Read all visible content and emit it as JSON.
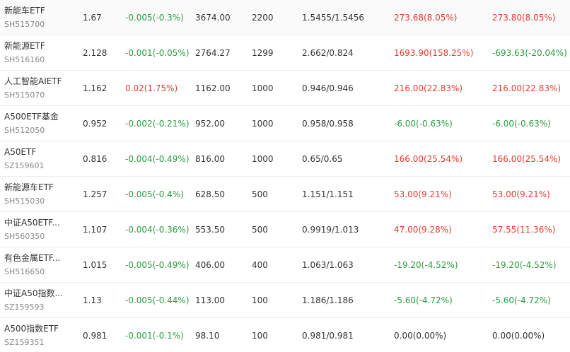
{
  "colors": {
    "up": "#e43c2f",
    "down": "#2a9d3f",
    "flat": "#333333"
  },
  "rows": [
    {
      "name": "新能车ETF",
      "code": "SH515700",
      "price": "1.67",
      "change": "-0.005(-0.3%)",
      "change_dir": "down",
      "market_value": "3674.00",
      "quantity": "2200",
      "cost": "1.5455/1.5456",
      "pnl": "273.68(8.05%)",
      "pnl_dir": "up",
      "pnl2": "273.80(8.05%)",
      "pnl2_dir": "up"
    },
    {
      "name": "新能源ETF",
      "code": "SH516160",
      "price": "2.128",
      "change": "-0.001(-0.05%)",
      "change_dir": "down",
      "market_value": "2764.27",
      "quantity": "1299",
      "cost": "2.662/0.824",
      "pnl": "1693.90(158.25%)",
      "pnl_dir": "up",
      "pnl2": "-693.63(-20.04%)",
      "pnl2_dir": "down"
    },
    {
      "name": "人工智能AIETF",
      "code": "SH515070",
      "price": "1.162",
      "change": "0.02(1.75%)",
      "change_dir": "up",
      "market_value": "1162.00",
      "quantity": "1000",
      "cost": "0.946/0.946",
      "pnl": "216.00(22.83%)",
      "pnl_dir": "up",
      "pnl2": "216.00(22.83%)",
      "pnl2_dir": "up"
    },
    {
      "name": "A500ETF基金",
      "code": "SH512050",
      "price": "0.952",
      "change": "-0.002(-0.21%)",
      "change_dir": "down",
      "market_value": "952.00",
      "quantity": "1000",
      "cost": "0.958/0.958",
      "pnl": "-6.00(-0.63%)",
      "pnl_dir": "down",
      "pnl2": "-6.00(-0.63%)",
      "pnl2_dir": "down"
    },
    {
      "name": "A50ETF",
      "code": "SZ159601",
      "price": "0.816",
      "change": "-0.004(-0.49%)",
      "change_dir": "down",
      "market_value": "816.00",
      "quantity": "1000",
      "cost": "0.65/0.65",
      "pnl": "166.00(25.54%)",
      "pnl_dir": "up",
      "pnl2": "166.00(25.54%)",
      "pnl2_dir": "up"
    },
    {
      "name": "新能源车ETF",
      "code": "SH515030",
      "price": "1.257",
      "change": "-0.005(-0.4%)",
      "change_dir": "down",
      "market_value": "628.50",
      "quantity": "500",
      "cost": "1.151/1.151",
      "pnl": "53.00(9.21%)",
      "pnl_dir": "up",
      "pnl2": "53.00(9.21%)",
      "pnl2_dir": "up"
    },
    {
      "name": "中证A50ETF...",
      "code": "SH560350",
      "price": "1.107",
      "change": "-0.004(-0.36%)",
      "change_dir": "down",
      "market_value": "553.50",
      "quantity": "500",
      "cost": "0.9919/1.013",
      "pnl": "47.00(9.28%)",
      "pnl_dir": "up",
      "pnl2": "57.55(11.36%)",
      "pnl2_dir": "up"
    },
    {
      "name": "有色金属ETF...",
      "code": "SH516650",
      "price": "1.015",
      "change": "-0.005(-0.49%)",
      "change_dir": "down",
      "market_value": "406.00",
      "quantity": "400",
      "cost": "1.063/1.063",
      "pnl": "-19.20(-4.52%)",
      "pnl_dir": "down",
      "pnl2": "-19.20(-4.52%)",
      "pnl2_dir": "down"
    },
    {
      "name": "中证A50指数...",
      "code": "SZ159593",
      "price": "1.13",
      "change": "-0.005(-0.44%)",
      "change_dir": "down",
      "market_value": "113.00",
      "quantity": "100",
      "cost": "1.186/1.186",
      "pnl": "-5.60(-4.72%)",
      "pnl_dir": "down",
      "pnl2": "-5.60(-4.72%)",
      "pnl2_dir": "down"
    },
    {
      "name": "A500指数ETF",
      "code": "SZ159351",
      "price": "0.981",
      "change": "-0.001(-0.1%)",
      "change_dir": "down",
      "market_value": "98.10",
      "quantity": "100",
      "cost": "0.981/0.981",
      "pnl": "0.00(0.00%)",
      "pnl_dir": "flat",
      "pnl2": "0.00(0.00%)",
      "pnl2_dir": "flat"
    }
  ]
}
